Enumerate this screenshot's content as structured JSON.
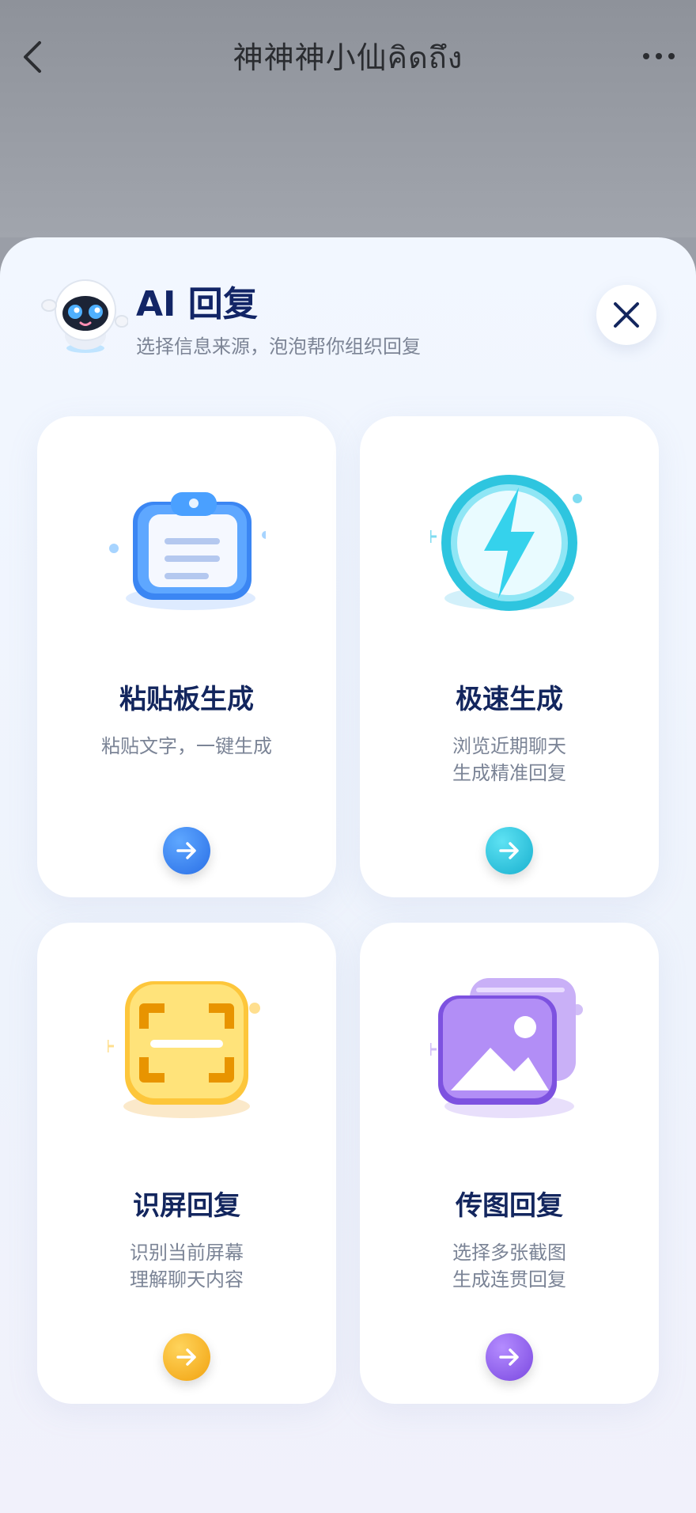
{
  "nav": {
    "title": "神神神小仙คิดถึง",
    "back_icon": "chevron-left-icon",
    "more_icon": "more-dots-icon"
  },
  "sheet": {
    "title": "AI 回复",
    "subtitle": "选择信息来源，泡泡帮你组织回复",
    "close_icon": "close-icon",
    "mascot_icon": "robot-mascot-icon"
  },
  "cards": [
    {
      "title": "粘贴板生成",
      "desc": [
        "粘贴文字，一键生成"
      ],
      "icon": "clipboard-icon",
      "accent": "#3c84f2"
    },
    {
      "title": "极速生成",
      "desc": [
        "浏览近期聊天",
        "生成精准回复"
      ],
      "icon": "lightning-icon",
      "accent": "#2bbfd9"
    },
    {
      "title": "识屏回复",
      "desc": [
        "识别当前屏幕",
        "理解聊天内容"
      ],
      "icon": "scan-screen-icon",
      "accent": "#f5b227"
    },
    {
      "title": "传图回复",
      "desc": [
        "选择多张截图",
        "生成连贯回复"
      ],
      "icon": "image-stack-icon",
      "accent": "#8c5ce6"
    }
  ]
}
